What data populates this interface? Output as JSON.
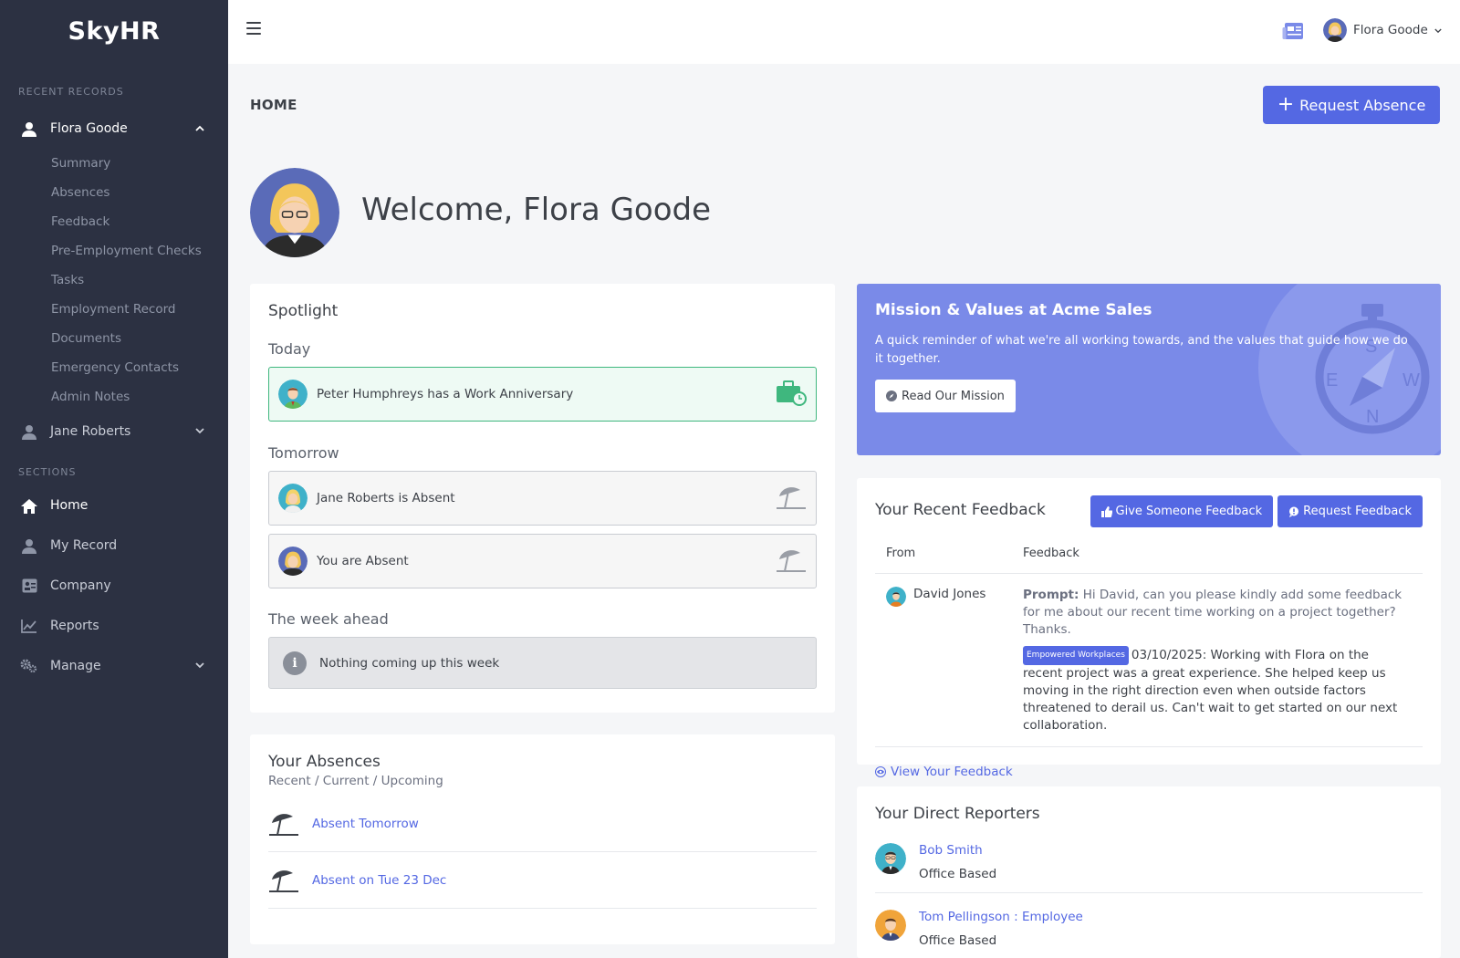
{
  "app": {
    "brand": "SkyHR"
  },
  "sidebar": {
    "recent_label": "RECENT RECORDS",
    "recent": [
      {
        "name": "Flora Goode",
        "expanded": true,
        "icon": "user-icon"
      },
      {
        "name": "Jane Roberts",
        "expanded": false,
        "icon": "user-icon"
      }
    ],
    "sub_items": [
      "Summary",
      "Absences",
      "Feedback",
      "Pre-Employment Checks",
      "Tasks",
      "Employment Record",
      "Documents",
      "Emergency Contacts",
      "Admin Notes"
    ],
    "sections_label": "SECTIONS",
    "sections": [
      {
        "label": "Home",
        "icon": "home-icon",
        "active": true
      },
      {
        "label": "My Record",
        "icon": "user-icon"
      },
      {
        "label": "Company",
        "icon": "company-card-icon"
      },
      {
        "label": "Reports",
        "icon": "chart-icon"
      },
      {
        "label": "Manage",
        "icon": "gears-icon"
      }
    ]
  },
  "topbar": {
    "user": "Flora Goode"
  },
  "page": {
    "title": "HOME",
    "request_button": "Request Absence",
    "welcome": "Welcome, Flora Goode"
  },
  "spotlight": {
    "title": "Spotlight",
    "today_label": "Today",
    "today": "Peter Humphreys has a Work Anniversary",
    "tomorrow_label": "Tomorrow",
    "tomorrow": [
      "Jane Roberts is Absent",
      "You are Absent"
    ],
    "week_label": "The week ahead",
    "week": "Nothing coming up this week"
  },
  "mission": {
    "title": "Mission & Values at Acme Sales",
    "text": "A quick reminder of what we're all working towards, and the values that guide how we do it together.",
    "button": "Read Our Mission"
  },
  "feedback": {
    "title": "Your Recent Feedback",
    "give_button": "Give Someone Feedback",
    "request_button": "Request Feedback",
    "col_from": "From",
    "col_feedback": "Feedback",
    "row": {
      "from": "David Jones",
      "prompt_label": "Prompt:",
      "prompt": "Hi David, can you please kindly add some feedback for me about our recent time working on a project together? Thanks.",
      "badge": "Empowered Workplaces",
      "text": "03/10/2025: Working with Flora on the recent project was a great experience. She helped keep us moving in the right direction even when outside factors threatened to derail us. Can't wait to get started on our next collaboration."
    },
    "view_link": "View Your Feedback"
  },
  "absences": {
    "title": "Your Absences",
    "subtitle": "Recent / Current / Upcoming",
    "items": [
      "Absent Tomorrow",
      "Absent on Tue 23 Dec"
    ]
  },
  "reporters": {
    "title": "Your Direct Reporters",
    "items": [
      {
        "name": "Bob Smith",
        "location": "Office Based"
      },
      {
        "name": "Tom Pellingson : Employee",
        "location": "Office Based"
      }
    ]
  },
  "colors": {
    "accent": "#5468e3",
    "sidebar": "#2c3142",
    "mission": "#7a8ae8",
    "success": "#3fb77e"
  }
}
